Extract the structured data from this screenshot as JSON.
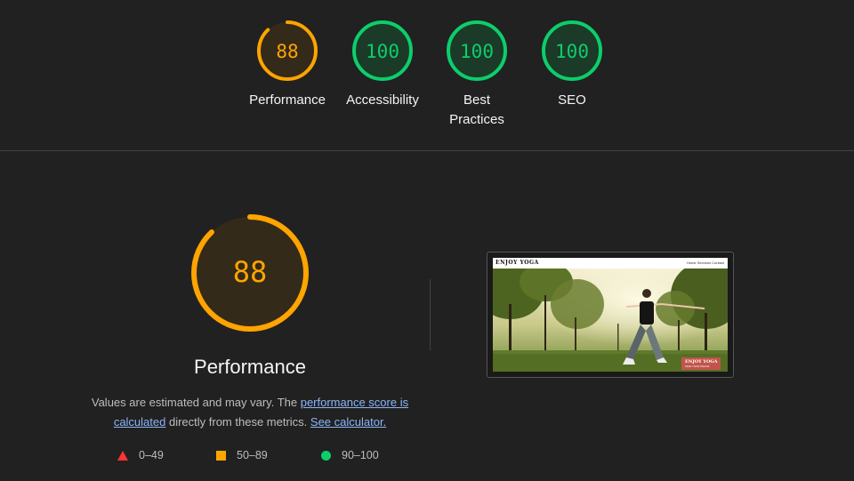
{
  "summary": {
    "gauges": [
      {
        "score": "88",
        "label_lines": [
          "Performance"
        ],
        "value": 0.88,
        "status": "average"
      },
      {
        "score": "100",
        "label_lines": [
          "Accessibility"
        ],
        "value": 1.0,
        "status": "pass"
      },
      {
        "score": "100",
        "label_lines": [
          "Best",
          "Practices"
        ],
        "value": 1.0,
        "status": "pass"
      },
      {
        "score": "100",
        "label_lines": [
          "SEO"
        ],
        "value": 1.0,
        "status": "pass"
      }
    ]
  },
  "performance": {
    "score": "88",
    "value": 0.88,
    "title": "Performance",
    "desc_prefix": "Values are estimated and may vary. The ",
    "link_score": "performance score is calculated",
    "desc_middle": " directly from these metrics. ",
    "link_calc": "See calculator."
  },
  "legend": [
    {
      "shape": "triangle",
      "range": "0–49"
    },
    {
      "shape": "square",
      "range": "50–89"
    },
    {
      "shape": "circle",
      "range": "90–100"
    }
  ],
  "screenshot": {
    "brand": "ENJOY YOGA",
    "nav_links": "Home   Services   Contact",
    "badge_title": "ENJOY YOGA",
    "badge_sub": "FIND YOUR PEACE"
  },
  "colors": {
    "background": "#212121",
    "average": "#ffa400",
    "average_bg": "#332a1a",
    "pass": "#0cce6b",
    "pass_bg": "#1b3a28",
    "fail": "#ff3333",
    "link": "#8ab4f8"
  }
}
